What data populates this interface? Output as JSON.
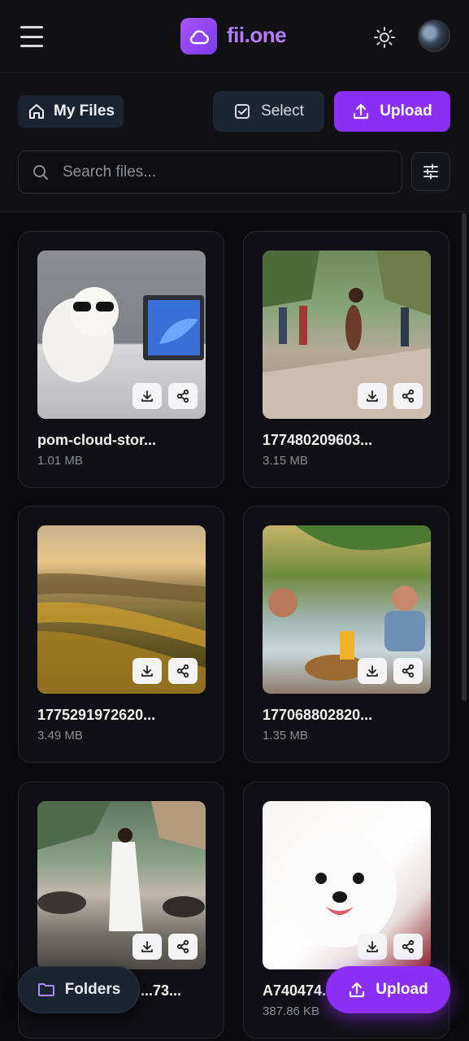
{
  "app": {
    "brand": "fii.one"
  },
  "toolbar": {
    "breadcrumb": "My Files",
    "select_label": "Select",
    "upload_label": "Upload"
  },
  "search": {
    "placeholder": "Search files..."
  },
  "files": [
    {
      "name": "pom-cloud-stor...",
      "size": "1.01 MB"
    },
    {
      "name": "177480209603...",
      "size": "3.15 MB"
    },
    {
      "name": "1775291972620...",
      "size": "3.49 MB"
    },
    {
      "name": "177068802820...",
      "size": "1.35 MB"
    },
    {
      "name": "...73...",
      "size": ""
    },
    {
      "name": "A740474...",
      "size": "387.86 KB"
    }
  ],
  "footer": {
    "folders_label": "Folders",
    "upload_label": "Upload"
  },
  "colors": {
    "accent": "#8b2ff5",
    "background": "#0b0b0d"
  }
}
